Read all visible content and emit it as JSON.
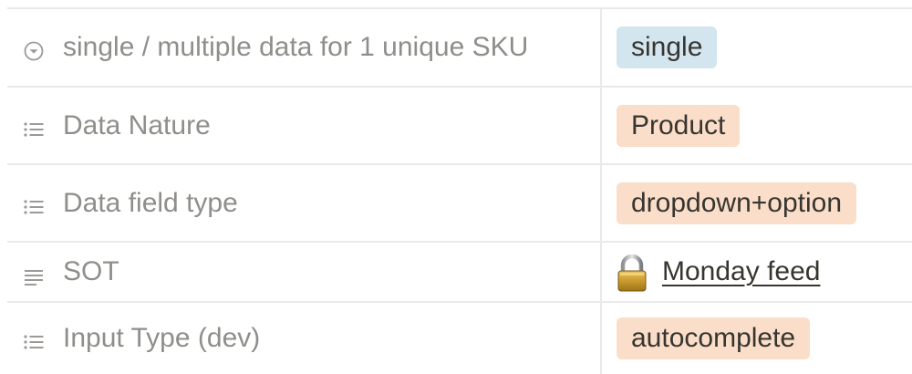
{
  "rows": [
    {
      "label": "single / multiple data for 1 unique SKU",
      "icon": "select-circle-icon",
      "value": "single",
      "tag_color": "#d3e5ef"
    },
    {
      "label": "Data Nature",
      "icon": "list-icon",
      "value": "Product",
      "tag_color": "#fadec9"
    },
    {
      "label": "Data field type",
      "icon": "list-icon",
      "value": "dropdown+option",
      "tag_color": "#fadec9"
    },
    {
      "label": "SOT",
      "icon": "text-lines-icon",
      "link_text": "Monday feed",
      "link_icon": "lock-icon"
    },
    {
      "label": "Input Type (dev)",
      "icon": "list-icon",
      "value": "autocomplete",
      "tag_color": "#fadec9"
    }
  ],
  "colors": {
    "label_text": "#8f8e8a",
    "value_text": "#37352f",
    "border": "#e9e9e7",
    "tag_blue": "#d3e5ef",
    "tag_orange": "#fadec9"
  }
}
